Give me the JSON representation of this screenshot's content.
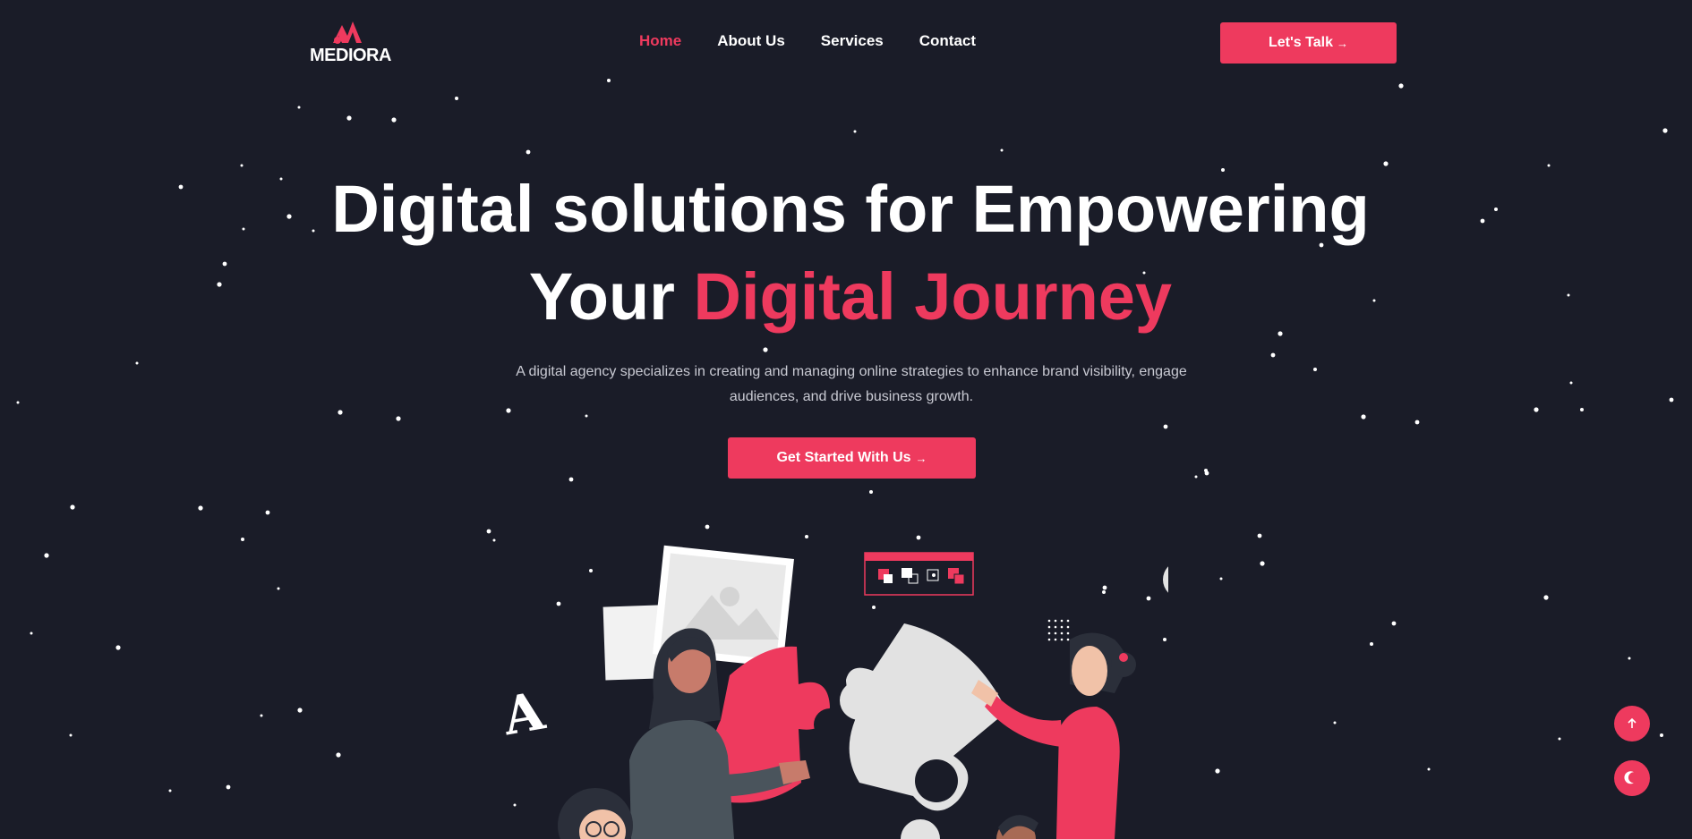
{
  "brand": {
    "name": "MEDIORA"
  },
  "nav": {
    "items": [
      {
        "label": "Home",
        "active": true
      },
      {
        "label": "About Us",
        "active": false
      },
      {
        "label": "Services",
        "active": false
      },
      {
        "label": "Contact",
        "active": false
      }
    ],
    "cta_label": "Let's Talk",
    "cta_icon": "arrow-right-icon"
  },
  "hero": {
    "title_line1": "Digital solutions for Empowering",
    "title_line2_plain": "Your",
    "title_line2_accent": "Digital Journey",
    "description": "A digital agency specializes in creating and managing online strategies to enhance brand visibility, engage audiences, and drive business growth.",
    "cta_label": "Get Started With Us",
    "cta_icon": "arrow-right-icon"
  },
  "floating": {
    "scroll_top_icon": "arrow-up-icon",
    "theme_icon": "moon-icon"
  },
  "colors": {
    "background": "#1a1c28",
    "accent": "#ee3a5e",
    "text": "#ffffff",
    "muted_text": "#c9cad3"
  }
}
